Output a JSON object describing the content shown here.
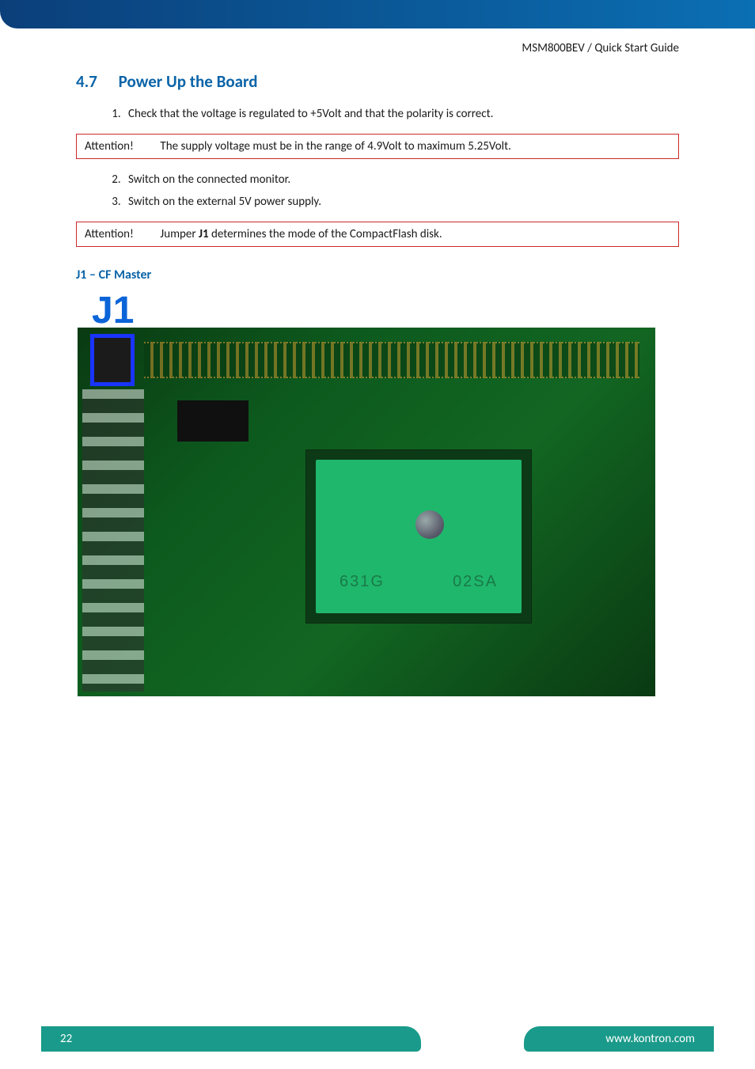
{
  "header": {
    "doc_title": "MSM800BEV / Quick Start Guide"
  },
  "section": {
    "number": "4.7",
    "title": "Power Up the Board"
  },
  "steps_first": [
    "Check that the voltage is regulated to +5Volt and that the polarity is correct."
  ],
  "attention1": {
    "label": "Attention!",
    "text": "The supply voltage must be in the range of 4.9Volt to maximum 5.25Volt."
  },
  "steps_second": [
    "Switch on the connected monitor.",
    "Switch on the external 5V power supply."
  ],
  "attention2": {
    "label": "Attention!",
    "prefix": "Jumper ",
    "bold": "J1",
    "suffix": " determines the mode of the CompactFlash disk."
  },
  "subheading": "J1 – CF Master",
  "jumper_label": "J1",
  "chip_markings": {
    "left": "631G",
    "right": "02SA"
  },
  "footer": {
    "page_number": "22",
    "url": "www.kontron.com"
  }
}
